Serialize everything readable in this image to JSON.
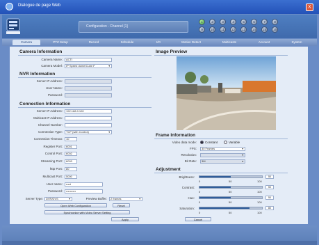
{
  "window": {
    "title": "Dialogue de page Web",
    "close": "X"
  },
  "header": {
    "config_label": "Configuration - Channel [1]",
    "channels": [
      "1",
      "2",
      "3",
      "4",
      "5",
      "6",
      "7",
      "8",
      "9",
      "10",
      "11",
      "12",
      "13",
      "14",
      "15",
      "16"
    ]
  },
  "tabs": [
    "Camera",
    "PTZ Setup",
    "Record",
    "Schedule",
    "I/O",
    "Motion Detect",
    "Multicasts",
    "Account",
    "System"
  ],
  "camera_info": {
    "heading": "Camera Information",
    "camera_name_label": "Camera Name:",
    "camera_name_value": "ACTI",
    "camera_model_label": "Camera Model:",
    "camera_model_value": "IP Speed dome/Cube F"
  },
  "nvr_info": {
    "heading": "NVR Information",
    "server_ip_label": "Server IP Address:",
    "user_name_label": "User Name:",
    "password_label": "Password:"
  },
  "connection": {
    "heading": "Connection Information",
    "fields": [
      {
        "label": "Server IP Address:",
        "value": "192.168.0.100"
      },
      {
        "label": "Multicast IP Address:",
        "value": ""
      },
      {
        "label": "Channel Number:",
        "value": ""
      },
      {
        "label": "Connection Type:",
        "value": "TCP (with Control)"
      },
      {
        "label": "Connection Timeout:",
        "value": "10"
      },
      {
        "label": "Register Port:",
        "value": "6001"
      },
      {
        "label": "Control Port:",
        "value": "6002"
      },
      {
        "label": "Streaming Port:",
        "value": "6003"
      },
      {
        "label": "http Port:",
        "value": "80"
      },
      {
        "label": "Multicast Port:",
        "value": "5000"
      },
      {
        "label": "User name:",
        "value": "root"
      },
      {
        "label": "Password:",
        "value": "••••••••••"
      }
    ],
    "server_type_label": "Server Type:",
    "server_type_value": "DVR/DVS",
    "preview_buffer_label": "Preview Buffer:",
    "preview_buffer_value": "2 frames",
    "open_web_button": "Open Web Configuration",
    "reset_button": "Reset",
    "sync_button": "Synchronize with Video Server Setting",
    "apply_button": "Apply"
  },
  "image_preview": {
    "heading": "Image Preview"
  },
  "frame_info": {
    "heading": "Frame Information",
    "video_data_label": "Video data mode:",
    "constant_label": "Constant",
    "variable_label": "Variable",
    "fps_label": "FPS:",
    "fps_value": "30 Frames",
    "resolution_label": "Resolution:",
    "resolution_value": "",
    "bitrate_label": "Bit Rate:",
    "bitrate_value": "3M"
  },
  "adjustment": {
    "heading": "Adjustment",
    "scale_min": "0",
    "scale_mid": "50",
    "scale_max": "100",
    "sliders": [
      {
        "label": "Brightness:",
        "value": "50",
        "fill": 0.5
      },
      {
        "label": "Contrast:",
        "value": "50",
        "fill": 0.5
      },
      {
        "label": "Hue:",
        "value": "50",
        "fill": 0.5
      },
      {
        "label": "Saturation:",
        "value": "80",
        "fill": 0.8
      }
    ],
    "cancel_button": "Cancel"
  },
  "colors": {
    "accent": "#2f5d9a",
    "titlebar": "#2352b8",
    "panel": "#e4ecf7"
  }
}
